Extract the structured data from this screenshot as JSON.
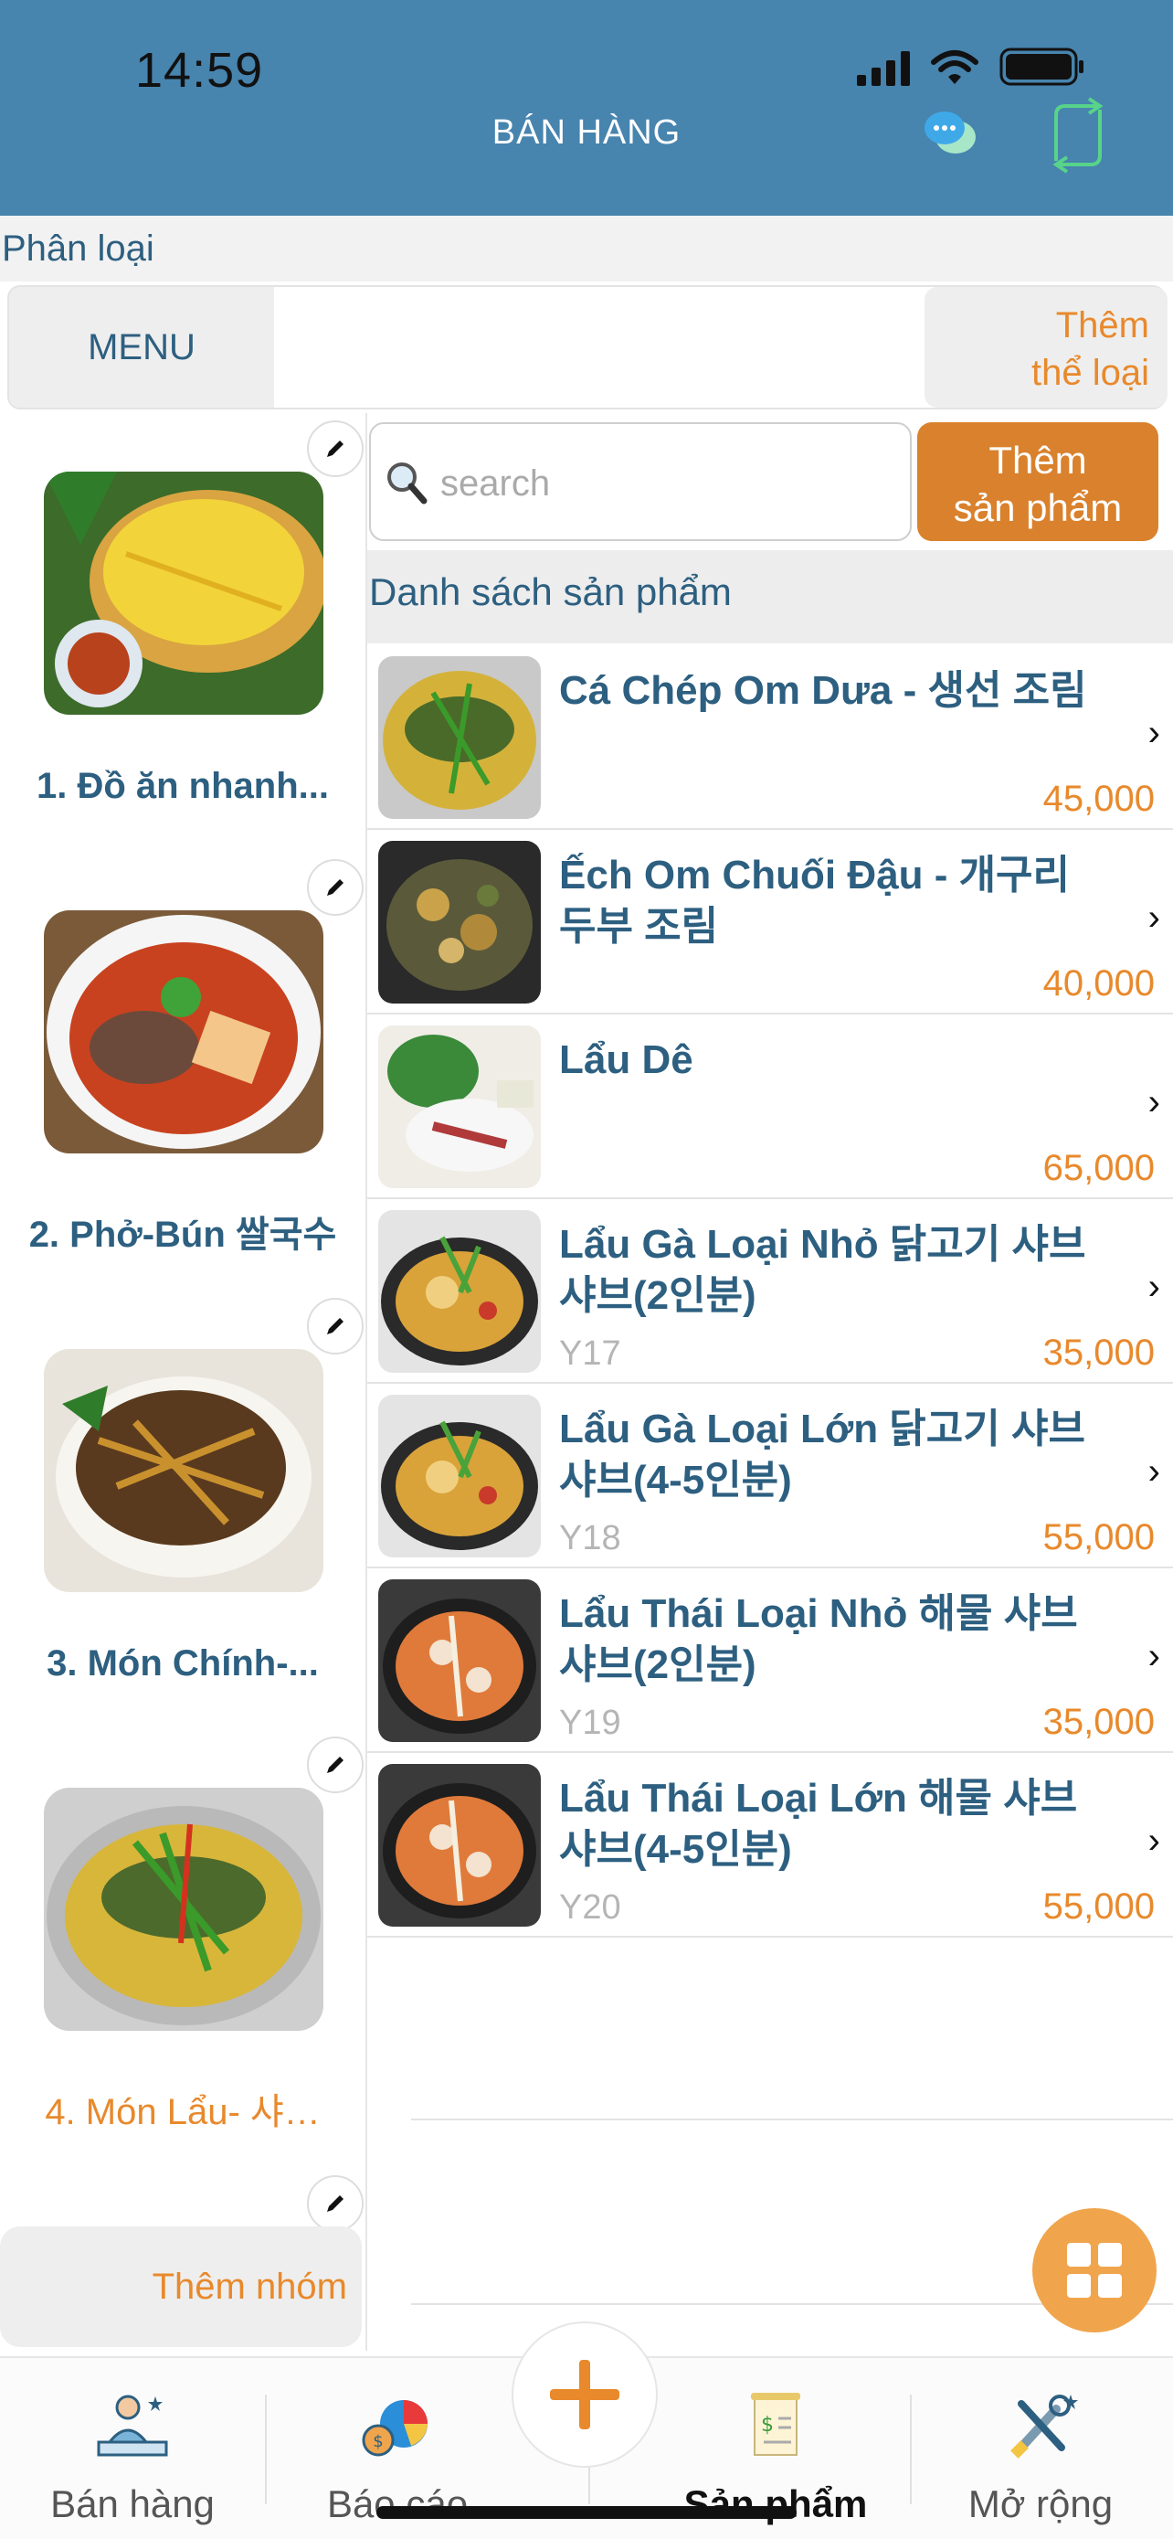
{
  "status": {
    "time": "14:59"
  },
  "header": {
    "title": "BÁN HÀNG"
  },
  "category": {
    "label": "Phân loại",
    "tabs": [
      {
        "label": "MENU"
      }
    ],
    "add_button": "Thêm\nthể loại"
  },
  "groups": [
    {
      "name": "1. Đồ ăn nhanh...",
      "active": false
    },
    {
      "name": "2. Phở-Bún 쌀국수",
      "active": false
    },
    {
      "name": "3. Món Chính-...",
      "active": false
    },
    {
      "name": "4. Món Lẩu- 샤…",
      "active": true
    }
  ],
  "add_group_button": "Thêm nhóm",
  "search": {
    "placeholder": "search"
  },
  "add_product_button": "Thêm\nsản phẩm",
  "list_header": "Danh sách sản phẩm",
  "products": [
    {
      "name": "Cá Chép Om Dưa - 생선 조림",
      "code": "",
      "price": "45,000"
    },
    {
      "name": "Ếch Om Chuối Đậu - 개구리 두부 조림",
      "code": "",
      "price": "40,000"
    },
    {
      "name": "Lẩu Dê",
      "code": "",
      "price": "65,000"
    },
    {
      "name": "Lẩu Gà Loại Nhỏ 닭고기 샤브샤브(2인분)",
      "code": "Y17",
      "price": "35,000"
    },
    {
      "name": "Lẩu Gà Loại Lớn 닭고기 샤브샤브(4-5인분)",
      "code": "Y18",
      "price": "55,000"
    },
    {
      "name": "Lẩu Thái Loại Nhỏ 해물 샤브샤브(2인분)",
      "code": "Y19",
      "price": "35,000"
    },
    {
      "name": "Lẩu Thái Loại Lớn 해물 샤브샤브(4-5인분)",
      "code": "Y20",
      "price": "55,000"
    }
  ],
  "tabbar": {
    "tabs": [
      {
        "label": "Bán hàng",
        "icon": "cashier-icon"
      },
      {
        "label": "Báo cáo",
        "icon": "report-chart-icon"
      },
      {
        "label": "Sản phẩm",
        "icon": "product-receipt-icon",
        "active": true
      },
      {
        "label": "Mở rộng",
        "icon": "tools-icon"
      }
    ],
    "center_icon": "plus-icon"
  },
  "colors": {
    "header": "#4784ae",
    "accent": "#e8892c",
    "text": "#2d5f80"
  }
}
